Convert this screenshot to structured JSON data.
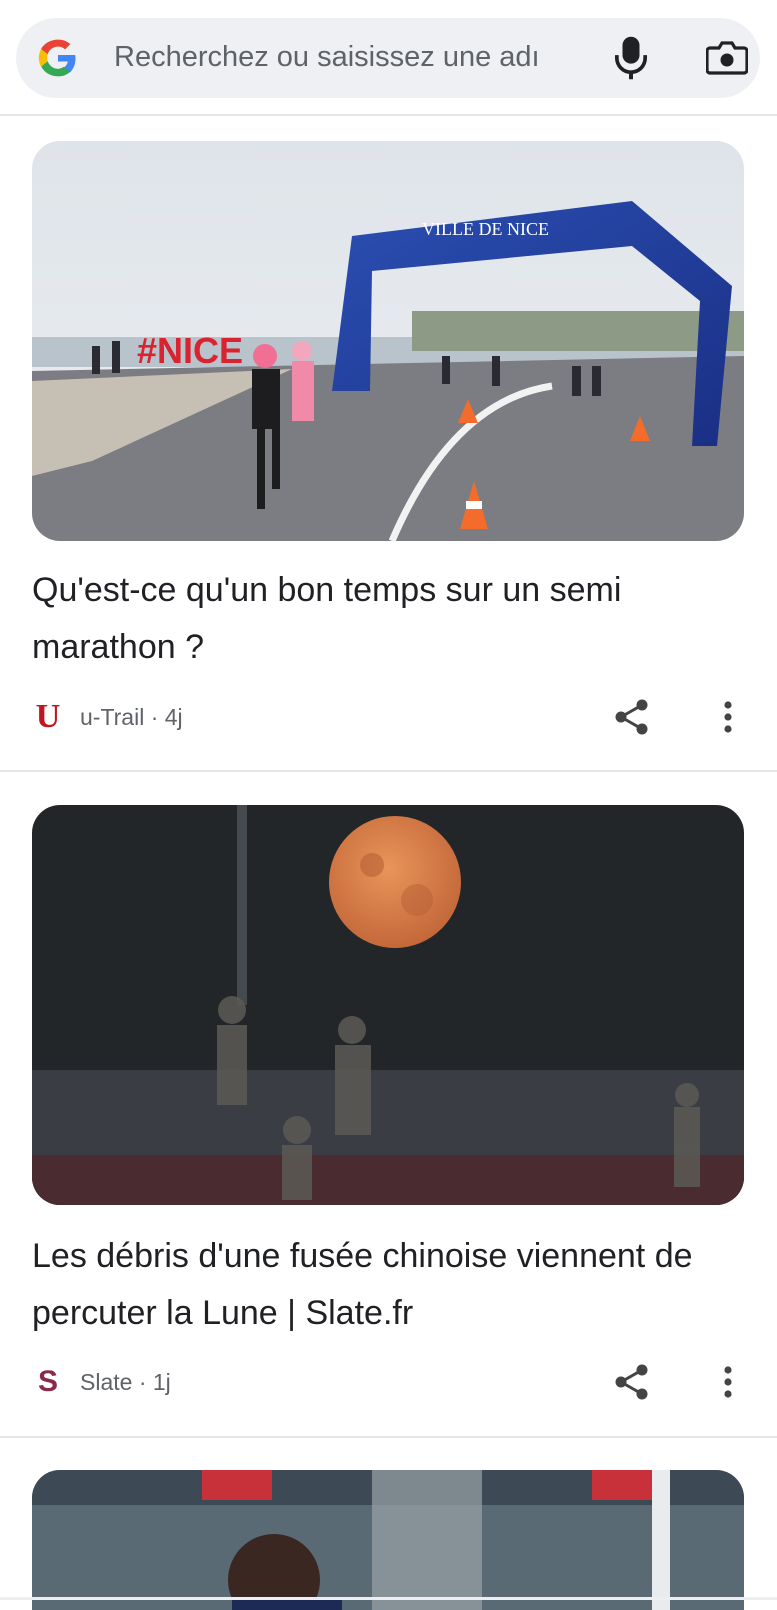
{
  "search": {
    "placeholder": "Recherchez ou saisissez une adı",
    "icons": [
      "google-logo-icon",
      "microphone-icon",
      "lens-camera-icon"
    ]
  },
  "feed": [
    {
      "image_icon": "nice-half-marathon-photo",
      "headline": "Qu'est-ce qu'un bon temps sur un semi marathon ?",
      "source_letter": "U",
      "source": "u-Trail · 4j",
      "source_color": "#c0161f"
    },
    {
      "image_icon": "moon-over-stadium-photo",
      "headline": "Les débris d'une fusée chinoise viennent de percuter la Lune | Slate.fr",
      "source_letter": "S",
      "source": "Slate · 1j",
      "source_color": "#8a2a4a"
    },
    {
      "image_icon": "football-player-photo"
    }
  ],
  "colors": {
    "search_bg": "#eef0f3",
    "divider": "#e3e5e8",
    "secondary_text": "#5f6368"
  }
}
